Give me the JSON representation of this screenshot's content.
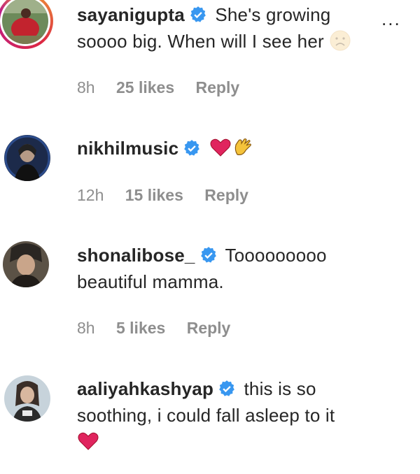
{
  "comments": [
    {
      "username": "sayanigupta",
      "text": "She's growing soooo big. When will I see her",
      "time": "8h",
      "likes": "25 likes",
      "reply": "Reply"
    },
    {
      "username": "nikhilmusic",
      "text": "",
      "time": "12h",
      "likes": "15 likes",
      "reply": "Reply"
    },
    {
      "username": "shonalibose_",
      "text": "Tooooooooo beautiful mamma.",
      "time": "8h",
      "likes": "5 likes",
      "reply": "Reply"
    },
    {
      "username": "aaliyahkashyap",
      "text": "this is so soothing, i could fall asleep to it",
      "time": "",
      "likes": "",
      "reply": ""
    }
  ],
  "more_options": "...",
  "colors": {
    "verified": "#3897f0",
    "meta": "#8e8e8e",
    "text": "#262626",
    "heart": "#e0245e"
  }
}
